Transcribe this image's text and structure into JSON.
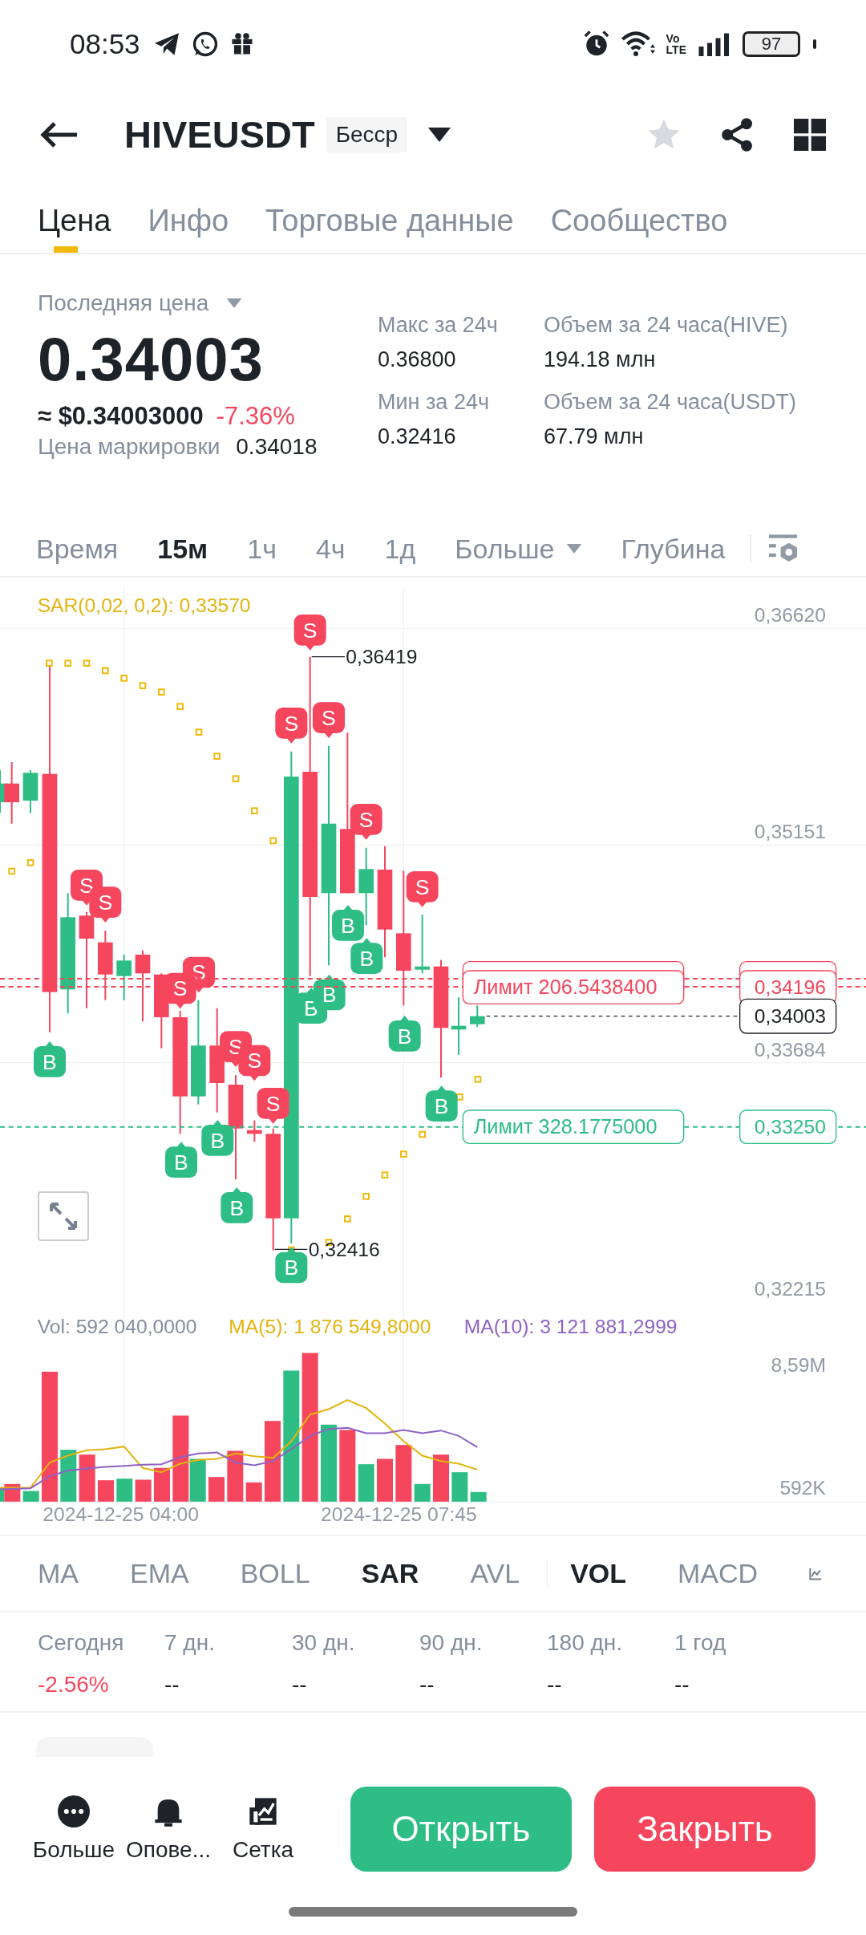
{
  "status_bar": {
    "time": "08:53",
    "network": {
      "top": "Vo",
      "bottom": "LTE"
    },
    "battery": "97"
  },
  "header": {
    "symbol": "HIVEUSDT",
    "badge": "Бесср",
    "favorite": false
  },
  "tabs": [
    {
      "label": "Цена",
      "selected": true
    },
    {
      "label": "Инфо",
      "selected": false
    },
    {
      "label": "Торговые данные",
      "selected": false
    },
    {
      "label": "Сообщество",
      "selected": false
    }
  ],
  "price": {
    "label": "Последняя цена",
    "last": "0.34003",
    "usd": "≈ $0.34003000",
    "change": "-7.36%",
    "mark_label": "Цена маркировки",
    "mark": "0.34018"
  },
  "stats": [
    {
      "label": "Макс за 24ч",
      "value": "0.36800"
    },
    {
      "label": "Объем за 24 часа(HIVE)",
      "value": "194.18 млн"
    },
    {
      "label": "Мин за 24ч",
      "value": "0.32416"
    },
    {
      "label": "Объем за 24 часа(USDT)",
      "value": "67.79 млн"
    }
  ],
  "intervals": [
    {
      "label": "Время",
      "selected": false,
      "dropdown": false
    },
    {
      "label": "15м",
      "selected": true,
      "dropdown": false
    },
    {
      "label": "1ч",
      "selected": false,
      "dropdown": false
    },
    {
      "label": "4ч",
      "selected": false,
      "dropdown": false
    },
    {
      "label": "1д",
      "selected": false,
      "dropdown": false
    },
    {
      "label": "Больше",
      "selected": false,
      "dropdown": true
    },
    {
      "label": "Глубина",
      "selected": false,
      "dropdown": false
    }
  ],
  "chart": {
    "sar_legend": "SAR(0,02, 0,2): 0,33570",
    "axis": [
      "0,36620",
      "0,35151",
      "0,33684",
      "0,32215"
    ],
    "high": "0,36419",
    "low": "0,32416",
    "last_price": "0,34003",
    "orders": [
      {
        "kind": "sell",
        "text": "Лимит  206.5438400",
        "price": "0,34196"
      },
      {
        "kind": "buy",
        "text": "Лимит  328.1775000",
        "price": "0,33250"
      }
    ],
    "marks": [
      {
        "kind": "sell",
        "label": "S"
      },
      {
        "kind": "sell",
        "label": "S"
      },
      {
        "kind": "sell",
        "label": "S"
      },
      {
        "kind": "sell",
        "label": "S"
      },
      {
        "kind": "sell",
        "label": "S"
      },
      {
        "kind": "sell",
        "label": "S"
      },
      {
        "kind": "sell",
        "label": "S"
      },
      {
        "kind": "sell",
        "label": "S"
      },
      {
        "kind": "sell",
        "label": "S"
      },
      {
        "kind": "sell",
        "label": "S"
      },
      {
        "kind": "sell",
        "label": "S"
      },
      {
        "kind": "sell",
        "label": "S"
      },
      {
        "kind": "buy",
        "label": "B"
      },
      {
        "kind": "buy",
        "label": "B"
      },
      {
        "kind": "buy",
        "label": "B"
      },
      {
        "kind": "buy",
        "label": "B"
      },
      {
        "kind": "buy",
        "label": "B"
      },
      {
        "kind": "buy",
        "label": "B"
      },
      {
        "kind": "buy",
        "label": "B"
      },
      {
        "kind": "buy",
        "label": "B"
      },
      {
        "kind": "buy",
        "label": "B"
      },
      {
        "kind": "buy",
        "label": "B"
      },
      {
        "kind": "buy",
        "label": "B"
      }
    ]
  },
  "volume": {
    "legend": [
      {
        "kind": "vol",
        "text": "Vol: 592 040,0000"
      },
      {
        "kind": "ma5",
        "text": "MA(5): 1 876 549,8000"
      },
      {
        "kind": "ma10",
        "text": "MA(10): 3 121 881,2999"
      }
    ],
    "axis": [
      "8,59M",
      "592K"
    ],
    "dates": [
      "2024-12-25 04:00",
      "2024-12-25 07:45"
    ]
  },
  "indicators": [
    {
      "label": "MA",
      "selected": false
    },
    {
      "label": "EMA",
      "selected": false
    },
    {
      "label": "BOLL",
      "selected": false
    },
    {
      "label": "SAR",
      "selected": true
    },
    {
      "label": "AVL",
      "selected": false
    },
    {
      "label": "VOL",
      "selected": true
    },
    {
      "label": "MACD",
      "selected": false
    }
  ],
  "periods": [
    {
      "label": "Сегодня",
      "value": "-2.56%",
      "kind": "down"
    },
    {
      "label": "7 дн.",
      "value": "--",
      "kind": "none"
    },
    {
      "label": "30 дн.",
      "value": "--",
      "kind": "none"
    },
    {
      "label": "90 дн.",
      "value": "--",
      "kind": "none"
    },
    {
      "label": "180 дн.",
      "value": "--",
      "kind": "none"
    },
    {
      "label": "1 год",
      "value": "--",
      "kind": "none"
    }
  ],
  "actions": [
    {
      "kind": "more",
      "label": "Больше"
    },
    {
      "kind": "alert",
      "label": "Опове..."
    },
    {
      "kind": "grid",
      "label": "Сетка"
    }
  ],
  "buttons": [
    {
      "kind": "buy",
      "label": "Открыть"
    },
    {
      "kind": "sell",
      "label": "Закрыть"
    }
  ]
}
